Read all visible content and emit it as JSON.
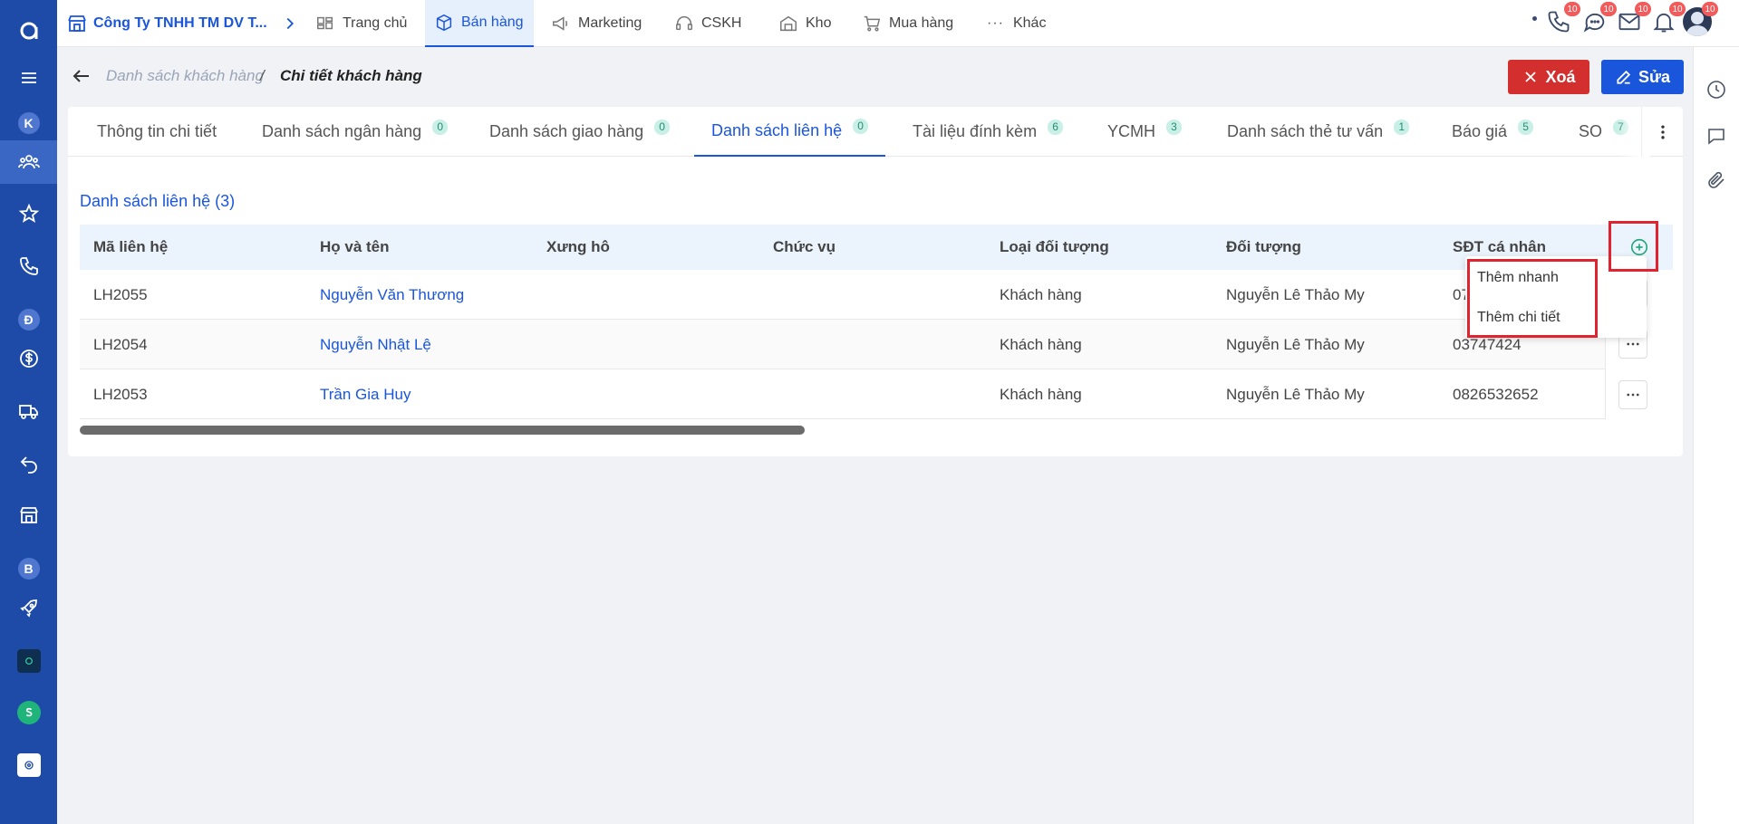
{
  "app": {
    "company_name": "Công Ty TNHH TM DV T...",
    "accent_color": "#1a56db",
    "sidebar_color": "#1f4ba8"
  },
  "sidebar": {
    "items": [
      {
        "icon": "logo-icon"
      },
      {
        "icon": "menu-icon"
      },
      {
        "letter": "K"
      },
      {
        "icon": "users-icon"
      },
      {
        "icon": "star-icon"
      },
      {
        "icon": "phone-icon"
      },
      {
        "letter": "Đ"
      },
      {
        "icon": "dollar-icon"
      },
      {
        "icon": "truck-icon"
      },
      {
        "icon": "return-icon"
      },
      {
        "icon": "store-icon"
      },
      {
        "letter": "B"
      },
      {
        "icon": "rocket-icon"
      },
      {
        "icon": "app-icon"
      },
      {
        "icon": "s-icon"
      },
      {
        "icon": "circle-app-icon"
      }
    ]
  },
  "topnav": {
    "items": [
      {
        "label": "Trang chủ",
        "icon": "home-icon"
      },
      {
        "label": "Bán hàng",
        "icon": "box-icon",
        "active": true
      },
      {
        "label": "Marketing",
        "icon": "megaphone-icon"
      },
      {
        "label": "CSKH",
        "icon": "support-icon"
      },
      {
        "label": "Kho",
        "icon": "warehouse-icon"
      },
      {
        "label": "Mua hàng",
        "icon": "cart-icon"
      },
      {
        "label": "Khác",
        "icon": "more-icon"
      }
    ],
    "notifications": {
      "phone": "10",
      "chat": "10",
      "mail": "10",
      "bell": "10",
      "avatar": "10"
    }
  },
  "breadcrumb": {
    "parent": "Danh sách khách hàng",
    "separator": "/",
    "current": "Chi tiết khách hàng"
  },
  "actions": {
    "delete_label": "Xoá",
    "edit_label": "Sửa"
  },
  "tabs": [
    {
      "label": "Thông tin chi tiết",
      "count": null
    },
    {
      "label": "Danh sách ngân hàng",
      "count": "0"
    },
    {
      "label": "Danh sách giao hàng",
      "count": "0"
    },
    {
      "label": "Danh sách liên hệ",
      "count": "0",
      "active": true
    },
    {
      "label": "Tài liệu đính kèm",
      "count": "6"
    },
    {
      "label": "YCMH",
      "count": "3"
    },
    {
      "label": "Danh sách thẻ tư vấn",
      "count": "1"
    },
    {
      "label": "Báo giá",
      "count": "5"
    },
    {
      "label": "SO",
      "count": "7"
    }
  ],
  "section": {
    "title": "Danh sách liên hệ (3)"
  },
  "table": {
    "columns": [
      "Mã liên hệ",
      "Họ và tên",
      "Xưng hô",
      "Chức vụ",
      "Loại đối tượng",
      "Đối tượng",
      "SĐT cá nhân"
    ],
    "rows": [
      {
        "code": "LH2055",
        "name": "Nguyễn Văn Thương",
        "salutation": "",
        "position": "",
        "type": "Khách hàng",
        "object": "Nguyễn Lê Thảo My",
        "phone": "07"
      },
      {
        "code": "LH2054",
        "name": "Nguyễn Nhật Lệ",
        "salutation": "",
        "position": "",
        "type": "Khách hàng",
        "object": "Nguyễn Lê Thảo My",
        "phone": "03747424"
      },
      {
        "code": "LH2053",
        "name": "Trần Gia Huy",
        "salutation": "",
        "position": "",
        "type": "Khách hàng",
        "object": "Nguyễn Lê Thảo My",
        "phone": "0826532652"
      }
    ]
  },
  "add_menu": {
    "items": [
      "Thêm nhanh",
      "Thêm chi tiết"
    ]
  }
}
